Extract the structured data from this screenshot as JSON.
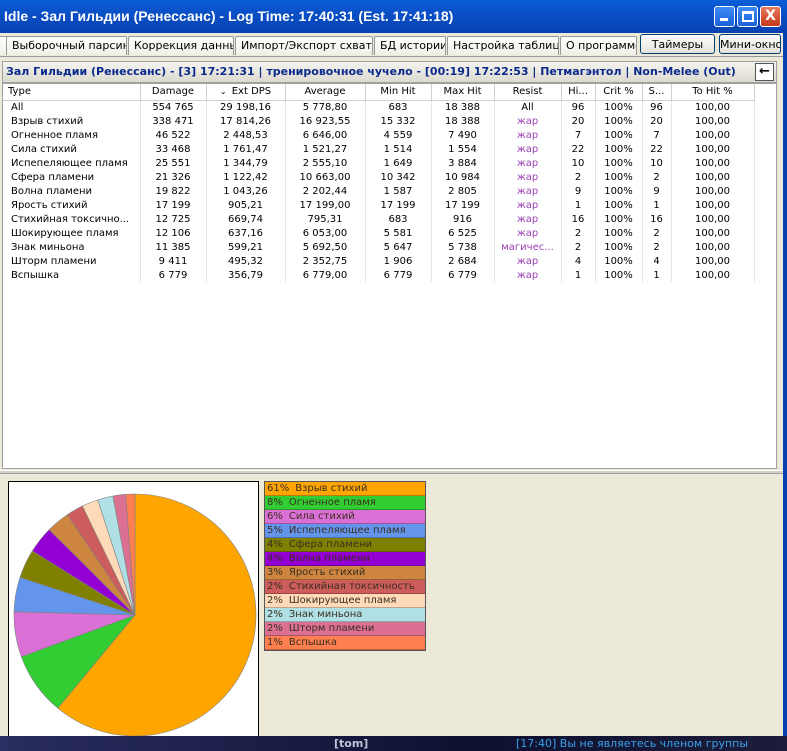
{
  "window": {
    "title": "Idle - Зал Гильдии (Ренессанс) - Log Time: 17:40:31 (Est. 17:41:18)",
    "btn_min": "_",
    "btn_max": "□",
    "btn_close": "X"
  },
  "tabs": [
    "Выборочный парсинг",
    "Коррекция данных",
    "Импорт/Экспорт схваток",
    "БД истории",
    "Настройка таблицы",
    "О программе"
  ],
  "buttons": {
    "timers": "Таймеры",
    "mini": "Мини-окно",
    "back": "←"
  },
  "encounter": {
    "text": "Зал Гильдии (Ренессанс) - [3] 17:21:31 | тренировочное чучело - [00:19] 17:22:53 | Петмагэнтол | Non-Melee (Out)"
  },
  "table": {
    "sort_indicator": "⌄",
    "headers": [
      "Type",
      "Damage",
      "Ext DPS",
      "Average",
      "Min Hit",
      "Max Hit",
      "Resist",
      "Hi...",
      "Crit %",
      "S...",
      "To Hit %"
    ],
    "rows": [
      [
        "All",
        "554 765",
        "29 198,16",
        "5 778,80",
        "683",
        "18 388",
        "All",
        "96",
        "100%",
        "96",
        "100,00"
      ],
      [
        "Взрыв стихий",
        "338 471",
        "17 814,26",
        "16 923,55",
        "15 332",
        "18 388",
        "жар",
        "20",
        "100%",
        "20",
        "100,00"
      ],
      [
        "Огненное пламя",
        "46 522",
        "2 448,53",
        "6 646,00",
        "4 559",
        "7 490",
        "жар",
        "7",
        "100%",
        "7",
        "100,00"
      ],
      [
        "Сила стихий",
        "33 468",
        "1 761,47",
        "1 521,27",
        "1 514",
        "1 554",
        "жар",
        "22",
        "100%",
        "22",
        "100,00"
      ],
      [
        "Испепеляющее пламя",
        "25 551",
        "1 344,79",
        "2 555,10",
        "1 649",
        "3 884",
        "жар",
        "10",
        "100%",
        "10",
        "100,00"
      ],
      [
        "Сфера пламени",
        "21 326",
        "1 122,42",
        "10 663,00",
        "10 342",
        "10 984",
        "жар",
        "2",
        "100%",
        "2",
        "100,00"
      ],
      [
        "Волна пламени",
        "19 822",
        "1 043,26",
        "2 202,44",
        "1 587",
        "2 805",
        "жар",
        "9",
        "100%",
        "9",
        "100,00"
      ],
      [
        "Ярость стихий",
        "17 199",
        "905,21",
        "17 199,00",
        "17 199",
        "17 199",
        "жар",
        "1",
        "100%",
        "1",
        "100,00"
      ],
      [
        "Стихийная токсично...",
        "12 725",
        "669,74",
        "795,31",
        "683",
        "916",
        "жар",
        "16",
        "100%",
        "16",
        "100,00"
      ],
      [
        "Шокирующее пламя",
        "12 106",
        "637,16",
        "6 053,00",
        "5 581",
        "6 525",
        "жар",
        "2",
        "100%",
        "2",
        "100,00"
      ],
      [
        "Знак миньона",
        "11 385",
        "599,21",
        "5 692,50",
        "5 647",
        "5 738",
        "магичес...",
        "2",
        "100%",
        "2",
        "100,00"
      ],
      [
        "Шторм пламени",
        "9 411",
        "495,32",
        "2 352,75",
        "1 906",
        "2 684",
        "жар",
        "4",
        "100%",
        "4",
        "100,00"
      ],
      [
        "Вспышка",
        "6 779",
        "356,79",
        "6 779,00",
        "6 779",
        "6 779",
        "жар",
        "1",
        "100%",
        "1",
        "100,00"
      ]
    ]
  },
  "chart_data": {
    "type": "pie",
    "title": "",
    "slices": [
      {
        "label": "Взрыв стихий",
        "pct_label": "61%",
        "value": 338471,
        "color": "#ffa500"
      },
      {
        "label": "Огненное пламя",
        "pct_label": "8%",
        "value": 46522,
        "color": "#32cd32"
      },
      {
        "label": "Сила стихий",
        "pct_label": "6%",
        "value": 33468,
        "color": "#da70d6"
      },
      {
        "label": "Испепеляющее пламя",
        "pct_label": "5%",
        "value": 25551,
        "color": "#6495ed"
      },
      {
        "label": "Сфера пламени",
        "pct_label": "4%",
        "value": 21326,
        "color": "#808000"
      },
      {
        "label": "Волна пламени",
        "pct_label": "4%",
        "value": 19822,
        "color": "#9400d3"
      },
      {
        "label": "Ярость стихий",
        "pct_label": "3%",
        "value": 17199,
        "color": "#cd853f"
      },
      {
        "label": "Стихийная токсичность",
        "pct_label": "2%",
        "value": 12725,
        "color": "#cd5c5c"
      },
      {
        "label": "Шокирующее пламя",
        "pct_label": "2%",
        "value": 12106,
        "color": "#ffdab9"
      },
      {
        "label": "Знак миньона",
        "pct_label": "2%",
        "value": 11385,
        "color": "#b0e0e6"
      },
      {
        "label": "Шторм пламени",
        "pct_label": "2%",
        "value": 9411,
        "color": "#db7093"
      },
      {
        "label": "Вспышка",
        "pct_label": "1%",
        "value": 6779,
        "color": "#ff7f50"
      }
    ]
  },
  "taskbar": {
    "left_text": "[tom]",
    "chat_text": "[17:40] Вы не являетесь членом группы"
  }
}
